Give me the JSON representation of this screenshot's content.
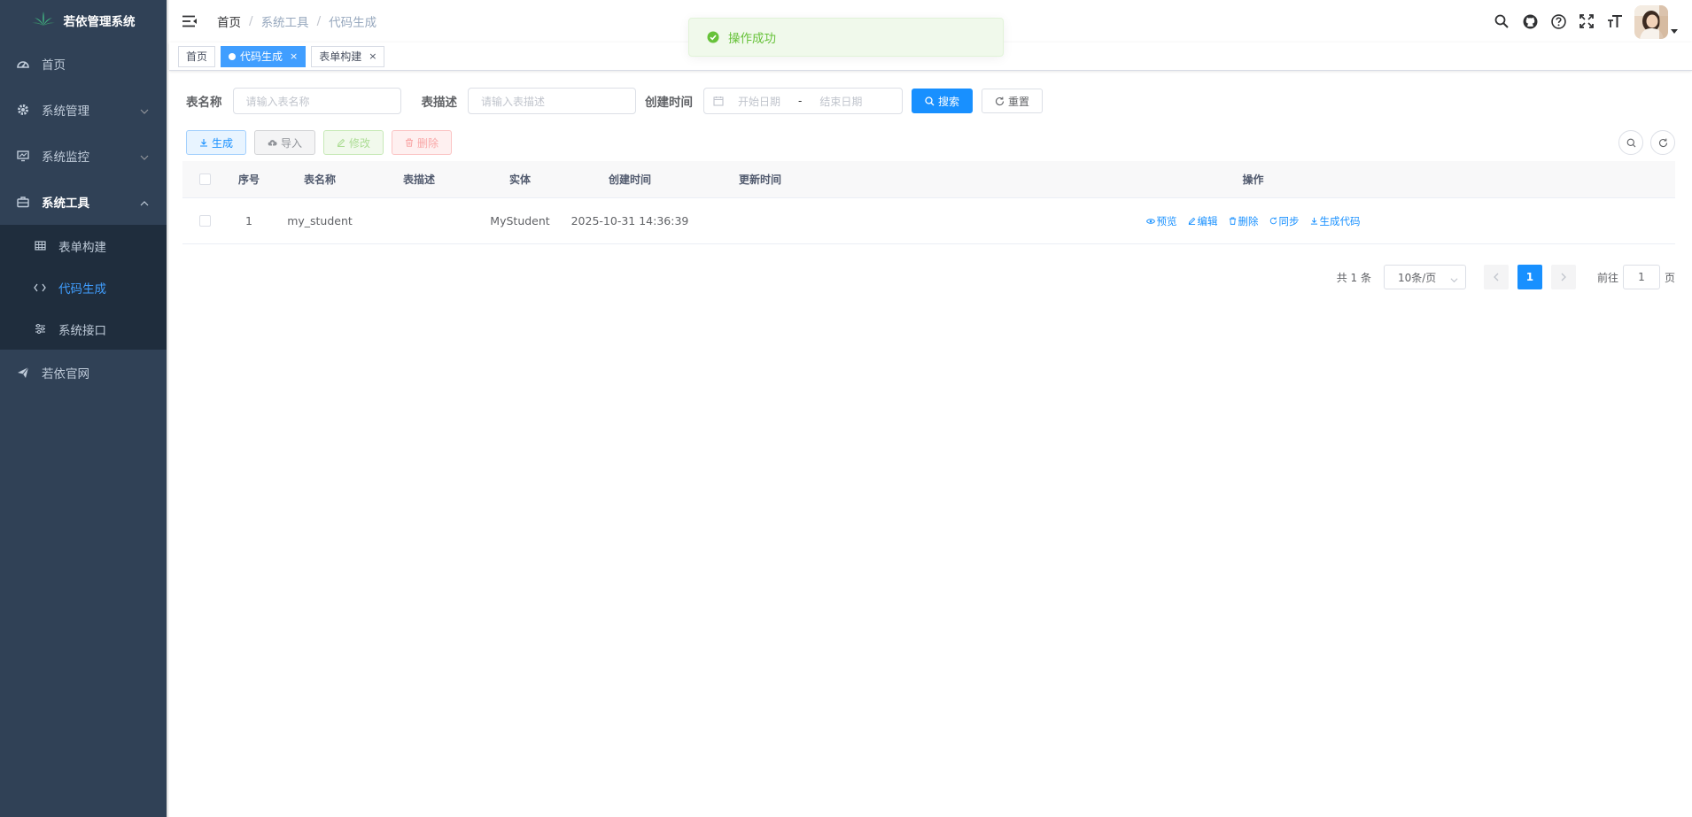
{
  "app": {
    "title": "若依管理系统"
  },
  "sidebar": {
    "items": [
      {
        "label": "首页",
        "icon": "dashboard-icon"
      },
      {
        "label": "系统管理",
        "icon": "gear-icon"
      },
      {
        "label": "系统监控",
        "icon": "monitor-icon"
      },
      {
        "label": "系统工具",
        "icon": "toolbox-icon",
        "expanded": true,
        "children": [
          {
            "label": "表单构建",
            "icon": "grid-icon"
          },
          {
            "label": "代码生成",
            "icon": "code-icon",
            "active": true
          },
          {
            "label": "系统接口",
            "icon": "sliders-icon"
          }
        ]
      },
      {
        "label": "若依官网",
        "icon": "send-icon"
      }
    ]
  },
  "breadcrumb": [
    "首页",
    "系统工具",
    "代码生成"
  ],
  "tags": [
    {
      "label": "首页",
      "active": false
    },
    {
      "label": "代码生成",
      "active": true
    },
    {
      "label": "表单构建",
      "active": false
    }
  ],
  "toast": {
    "message": "操作成功",
    "type": "success",
    "color": "#67c23a"
  },
  "search": {
    "table_name_label": "表名称",
    "table_name_placeholder": "请输入表名称",
    "table_desc_label": "表描述",
    "table_desc_placeholder": "请输入表描述",
    "create_time_label": "创建时间",
    "start_placeholder": "开始日期",
    "range_sep": "-",
    "end_placeholder": "结束日期",
    "search_btn": "搜索",
    "reset_btn": "重置"
  },
  "toolbar": {
    "generate": "生成",
    "import": "导入",
    "edit": "修改",
    "delete": "删除"
  },
  "table": {
    "columns": [
      "序号",
      "表名称",
      "表描述",
      "实体",
      "创建时间",
      "更新时间",
      "操作"
    ],
    "rows": [
      {
        "seq": "1",
        "table_name": "my_student",
        "table_desc": "",
        "entity": "MyStudent",
        "create_time": "2025-10-31 14:36:39",
        "update_time": ""
      }
    ],
    "row_actions": [
      "预览",
      "编辑",
      "删除",
      "同步",
      "生成代码"
    ]
  },
  "pagination": {
    "total_text": "共 1 条",
    "page_size": "10条/页",
    "current": "1",
    "goto_label": "前往",
    "goto_value": "1",
    "page_suffix": "页"
  },
  "colors": {
    "sidebar_bg": "#304156",
    "accent": "#1890ff",
    "active_menu": "#409eff"
  }
}
